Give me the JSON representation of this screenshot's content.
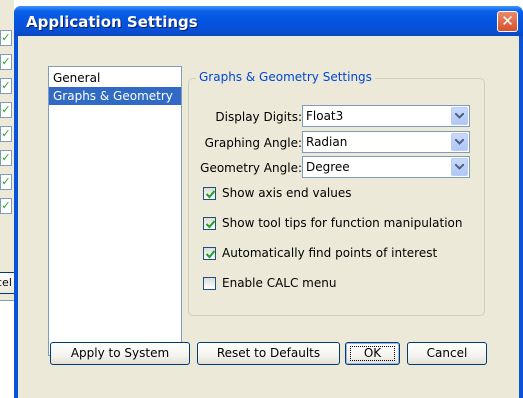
{
  "window": {
    "title": "Application Settings"
  },
  "background": {
    "button_fragment": "cel"
  },
  "categories": [
    {
      "label": "General",
      "selected": false
    },
    {
      "label": "Graphs & Geometry",
      "selected": true
    }
  ],
  "group": {
    "title": "Graphs & Geometry Settings",
    "fields": [
      {
        "label": "Display Digits:",
        "value": "Float3"
      },
      {
        "label": "Graphing Angle:",
        "value": "Radian"
      },
      {
        "label": "Geometry Angle:",
        "value": "Degree"
      }
    ],
    "checkboxes": [
      {
        "label": "Show axis end values",
        "checked": true
      },
      {
        "label": "Show tool tips for function manipulation",
        "checked": true
      },
      {
        "label": "Automatically find points of interest",
        "checked": true
      },
      {
        "label": "Enable CALC menu",
        "checked": false
      }
    ]
  },
  "buttons": {
    "apply": "Apply to System",
    "reset": "Reset to Defaults",
    "ok": "OK",
    "cancel": "Cancel"
  },
  "colors": {
    "titlebar": "#0454e0",
    "selection": "#316ac5",
    "group_title": "#0046d5",
    "dialog_bg": "#ece9d8"
  }
}
